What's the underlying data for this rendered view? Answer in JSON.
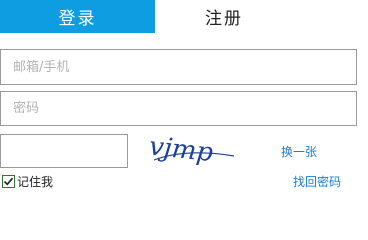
{
  "tabs": {
    "login_label": "登录",
    "register_label": "注册"
  },
  "form": {
    "email_placeholder": "邮箱/手机",
    "email_value": "",
    "password_placeholder": "密码",
    "password_value": "",
    "captcha_value": "",
    "captcha_image_text": "vjmp",
    "refresh_label": "换一张",
    "remember_label": "记住我",
    "remember_checked": true,
    "forgot_label": "找回密码"
  },
  "colors": {
    "accent": "#0e9de0",
    "link": "#1a7dd8",
    "captcha_ink": "#1e3f9a"
  },
  "icons": {
    "checkbox": "check-icon"
  }
}
